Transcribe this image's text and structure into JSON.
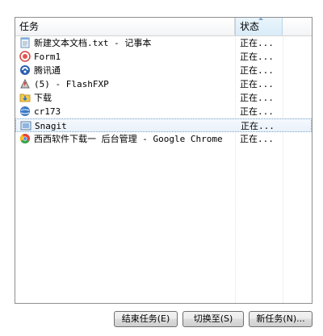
{
  "columns": {
    "task": "任务",
    "status": "状态"
  },
  "rows": [
    {
      "name": "新建文本文档.txt - 记事本",
      "status": "正在...",
      "icon": "notepad-icon",
      "selected": false
    },
    {
      "name": "Form1",
      "status": "正在...",
      "icon": "form-app-icon",
      "selected": false
    },
    {
      "name": "腾讯通",
      "status": "正在...",
      "icon": "rtx-icon",
      "selected": false
    },
    {
      "name": "(5) - FlashFXP",
      "status": "正在...",
      "icon": "flashfxp-icon",
      "selected": false
    },
    {
      "name": "下载",
      "status": "正在...",
      "icon": "folder-icon",
      "selected": false
    },
    {
      "name": "cr173",
      "status": "正在...",
      "icon": "globe-icon",
      "selected": false
    },
    {
      "name": "Snagit",
      "status": "正在...",
      "icon": "snagit-icon",
      "selected": true
    },
    {
      "name": "西西软件下载一 后台管理 - Google Chrome",
      "status": "正在...",
      "icon": "chrome-icon",
      "selected": false
    }
  ],
  "buttons": {
    "end_task": "结束任务(E)",
    "switch_to": "切换至(S)",
    "new_task": "新任务(N)..."
  },
  "colors": {
    "selection_border": "#7da2ce",
    "selected_header": "#d9ecf8"
  }
}
